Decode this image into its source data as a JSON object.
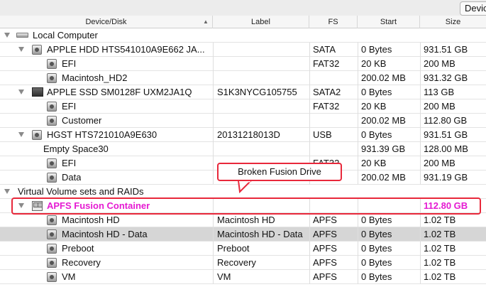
{
  "toolbar": {
    "device_button": "Device"
  },
  "columns": {
    "device": "Device/Disk",
    "label": "Label",
    "fs": "FS",
    "start": "Start",
    "size": "Size"
  },
  "rows": [
    {
      "name": "Local Computer",
      "label": "",
      "fs": "",
      "start": "",
      "size": ""
    },
    {
      "name": "APPLE HDD HTS541010A9E662 JA...",
      "label": "",
      "fs": "SATA",
      "start": "0 Bytes",
      "size": "931.51 GB"
    },
    {
      "name": "EFI",
      "label": "",
      "fs": "FAT32",
      "start": "20 KB",
      "size": "200 MB"
    },
    {
      "name": "Macintosh_HD2",
      "label": "",
      "fs": "",
      "start": "200.02 MB",
      "size": "931.32 GB"
    },
    {
      "name": "APPLE SSD SM0128F UXM2JA1Q",
      "label": "S1K3NYCG105755",
      "fs": "SATA2",
      "start": "0 Bytes",
      "size": "113 GB"
    },
    {
      "name": "EFI",
      "label": "",
      "fs": "FAT32",
      "start": "20 KB",
      "size": "200 MB"
    },
    {
      "name": "Customer",
      "label": "",
      "fs": "",
      "start": "200.02 MB",
      "size": "112.80 GB"
    },
    {
      "name": "HGST HTS721010A9E630",
      "label": "20131218013D",
      "fs": "USB",
      "start": "0 Bytes",
      "size": "931.51 GB"
    },
    {
      "name": "Empty Space30",
      "label": "",
      "fs": "",
      "start": "931.39 GB",
      "size": "128.00 MB"
    },
    {
      "name": "EFI",
      "label": "",
      "fs": "FAT32",
      "start": "20 KB",
      "size": "200 MB"
    },
    {
      "name": "Data",
      "label": "",
      "fs": "",
      "start": "200.02 MB",
      "size": "931.19 GB"
    },
    {
      "name": "Virtual Volume sets and RAIDs",
      "label": "",
      "fs": "",
      "start": "",
      "size": ""
    },
    {
      "name": "APFS Fusion Container",
      "label": "",
      "fs": "",
      "start": "",
      "size": "112.80 GB"
    },
    {
      "name": "Macintosh HD",
      "label": "Macintosh HD",
      "fs": "APFS",
      "start": "0 Bytes",
      "size": "1.02 TB"
    },
    {
      "name": "Macintosh HD - Data",
      "label": "Macintosh HD - Data",
      "fs": "APFS",
      "start": "0 Bytes",
      "size": "1.02 TB"
    },
    {
      "name": "Preboot",
      "label": "Preboot",
      "fs": "APFS",
      "start": "0 Bytes",
      "size": "1.02 TB"
    },
    {
      "name": "Recovery",
      "label": "Recovery",
      "fs": "APFS",
      "start": "0 Bytes",
      "size": "1.02 TB"
    },
    {
      "name": "VM",
      "label": "VM",
      "fs": "APFS",
      "start": "0 Bytes",
      "size": "1.02 TB"
    }
  ],
  "annotation": {
    "callout": "Broken Fusion Drive"
  },
  "colors": {
    "fusion_text": "#e51ad2",
    "annotation_red": "#e8283b",
    "selected_row": "#d6d6d6"
  }
}
